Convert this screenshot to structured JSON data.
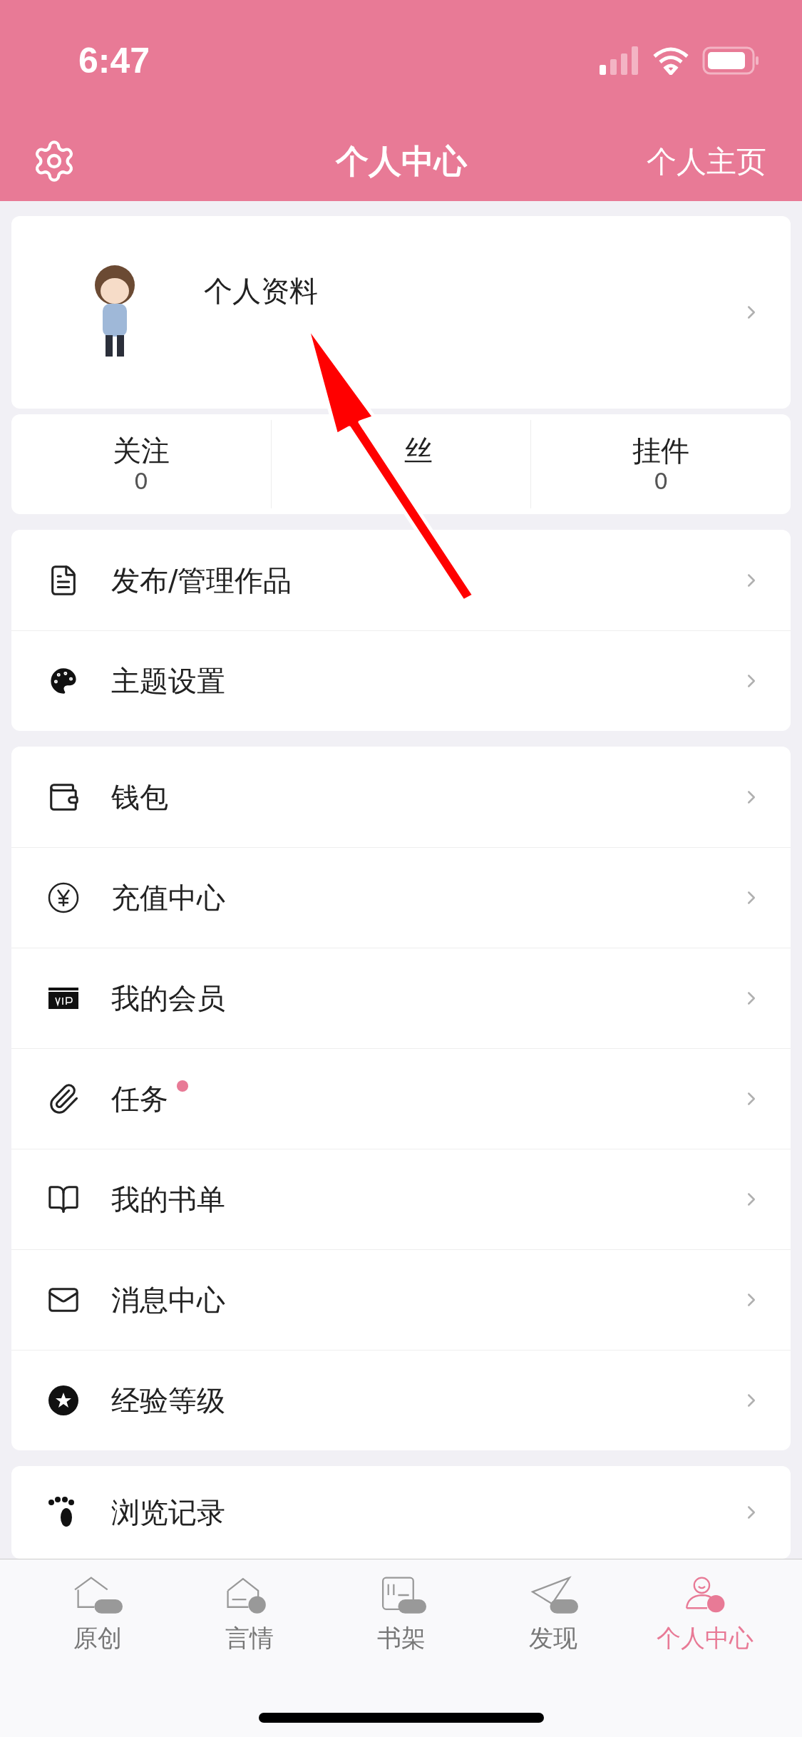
{
  "status_bar": {
    "time": "6:47"
  },
  "header": {
    "title": "个人中心",
    "right_link": "个人主页"
  },
  "profile": {
    "label": "个人资料"
  },
  "stats": [
    {
      "label": "关注",
      "count": "0"
    },
    {
      "label": "丝"
    },
    {
      "label": "挂件",
      "count": "0"
    }
  ],
  "groups": [
    [
      {
        "label": "发布/管理作品",
        "dot": false
      },
      {
        "label": "主题设置",
        "dot": false
      }
    ],
    [
      {
        "label": "钱包",
        "dot": false
      },
      {
        "label": "充值中心",
        "dot": false
      },
      {
        "label": "我的会员",
        "dot": false
      },
      {
        "label": "任务",
        "dot": true
      },
      {
        "label": "我的书单",
        "dot": false
      },
      {
        "label": "消息中心",
        "dot": false
      },
      {
        "label": "经验等级",
        "dot": false
      }
    ],
    [
      {
        "label": "浏览记录",
        "dot": false
      }
    ]
  ],
  "tabs": [
    {
      "label": "原创",
      "selected": false
    },
    {
      "label": "言情",
      "selected": false
    },
    {
      "label": "书架",
      "selected": false
    },
    {
      "label": "发现",
      "selected": false
    },
    {
      "label": "个人中心",
      "selected": true
    }
  ]
}
